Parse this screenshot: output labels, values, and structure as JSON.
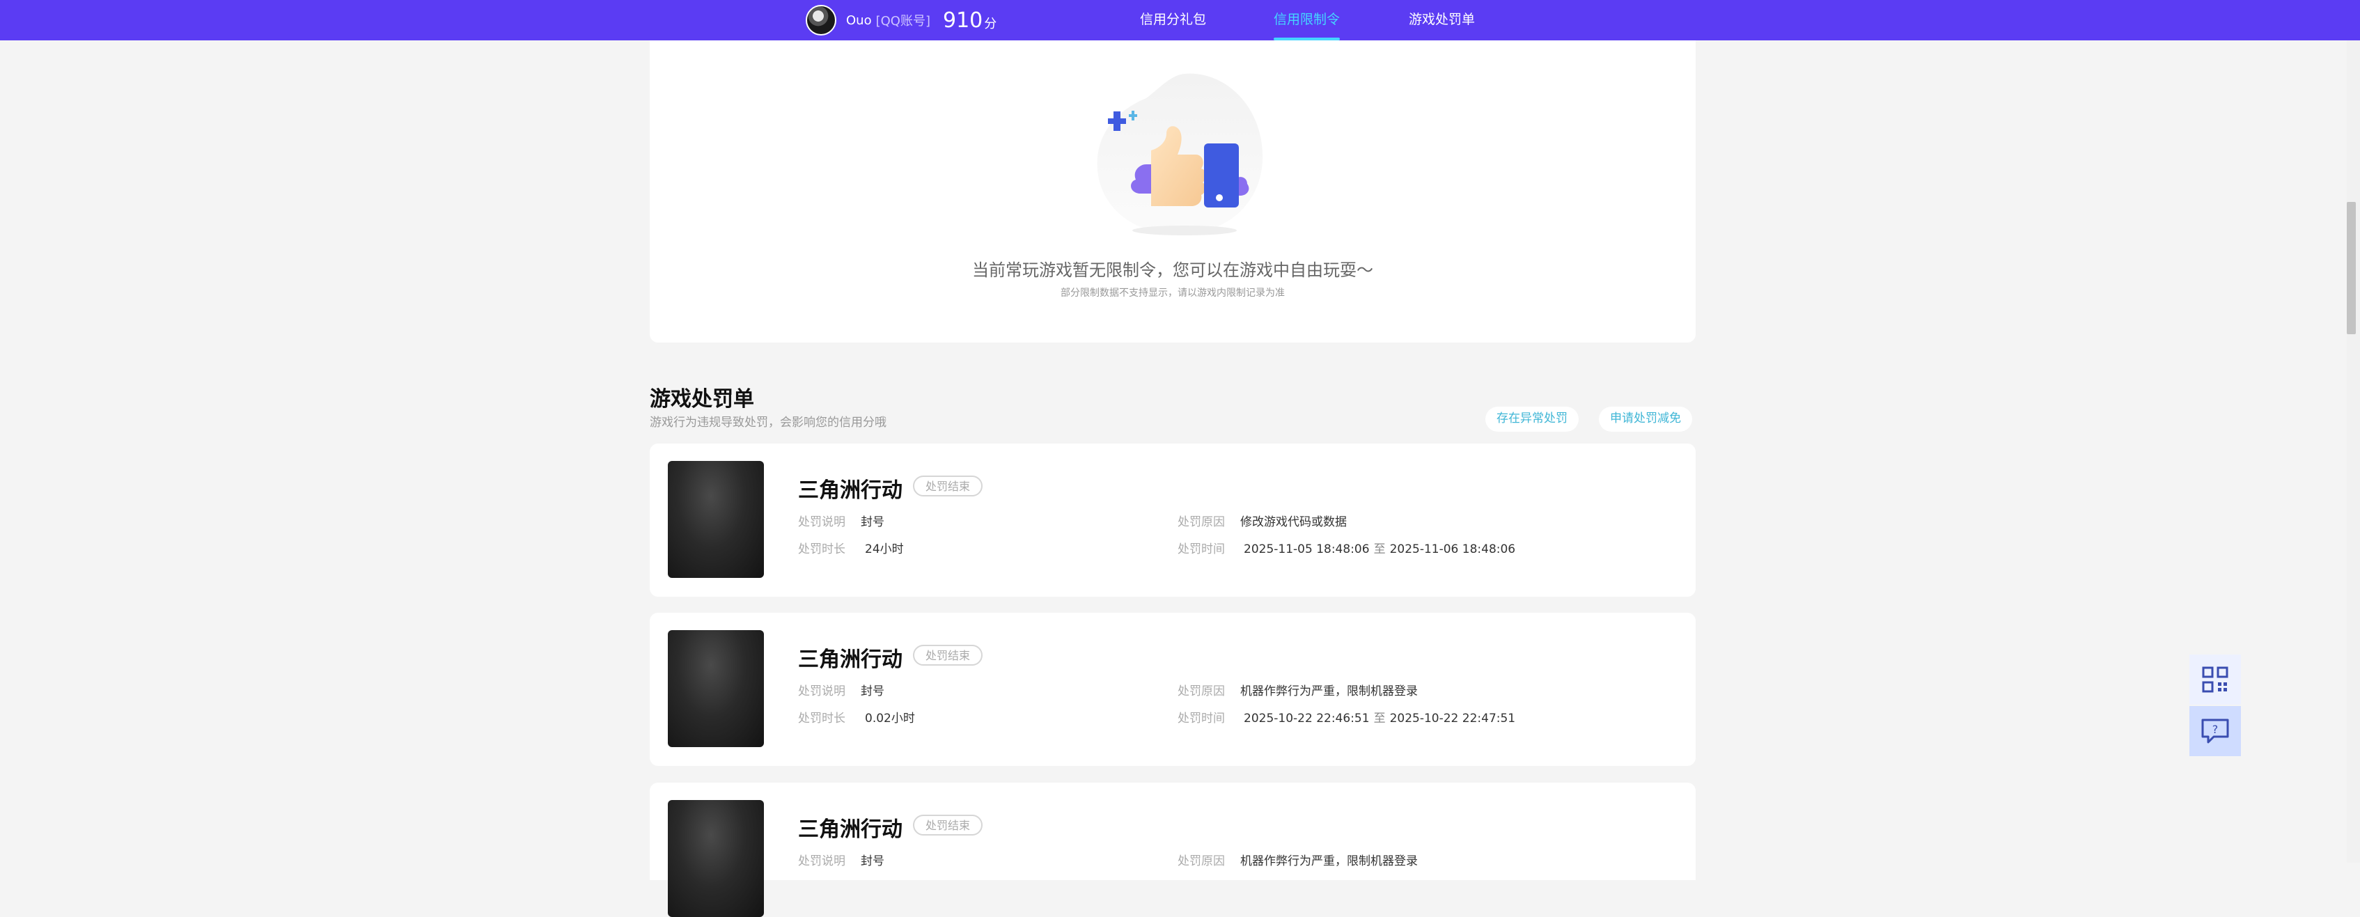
{
  "topbar": {
    "user_name": "Ouo",
    "account_type": "[QQ账号]",
    "score": "910",
    "score_unit": "分",
    "nav": [
      {
        "label": "信用分礼包",
        "active": false
      },
      {
        "label": "信用限制令",
        "active": true
      },
      {
        "label": "游戏处罚单",
        "active": false
      }
    ]
  },
  "restriction": {
    "empty_title": "当前常玩游戏暂无限制令，您可以在游戏中自由玩耍～",
    "empty_sub": "部分限制数据不支持显示，请以游戏内限制记录为准"
  },
  "penalty_section": {
    "title": "游戏处罚单",
    "subtitle": "游戏行为违规导致处罚，会影响您的信用分哦",
    "btn_abnormal": "存在异常处罚",
    "btn_appeal": "申请处罚减免"
  },
  "labels": {
    "desc": "处罚说明",
    "duration": "处罚时长",
    "reason": "处罚原因",
    "time": "处罚时间",
    "to": "至"
  },
  "records": [
    {
      "game": "三角洲行动",
      "status": "处罚结束",
      "desc": "封号",
      "duration": "24小时",
      "reason": "修改游戏代码或数据",
      "start": "2025-11-05 18:48:06",
      "end": "2025-11-06 18:48:06"
    },
    {
      "game": "三角洲行动",
      "status": "处罚结束",
      "desc": "封号",
      "duration": "0.02小时",
      "reason": "机器作弊行为严重，限制机器登录",
      "start": "2025-10-22 22:46:51",
      "end": "2025-10-22 22:47:51"
    },
    {
      "game": "三角洲行动",
      "status": "处罚结束",
      "desc": "封号",
      "reason": "机器作弊行为严重，限制机器登录"
    }
  ],
  "colors": {
    "topbar": "#5b3cf3",
    "active_nav": "#44d6ff",
    "pill_text": "#3fb6d6"
  },
  "icons": {
    "float_top": "qr-code-icon",
    "float_bottom": "help-feedback-icon"
  }
}
